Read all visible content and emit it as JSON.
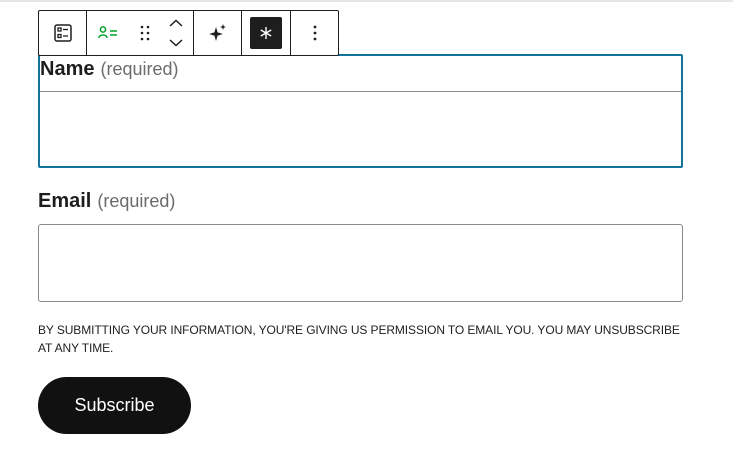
{
  "toolbar": {
    "buttons": [
      {
        "icon": "form-block-icon"
      },
      {
        "icon": "person-lines-icon",
        "color": "#00a32a"
      },
      {
        "icon": "drag-handle-icon"
      },
      {
        "icon": "chevron-up-icon"
      },
      {
        "icon": "chevron-down-icon"
      },
      {
        "icon": "sparkle-icon"
      },
      {
        "icon": "asterisk-icon",
        "active": true
      },
      {
        "icon": "more-options-icon"
      }
    ]
  },
  "fields": {
    "name": {
      "label": "Name",
      "required": "(required)",
      "value": ""
    },
    "email": {
      "label": "Email",
      "required": "(required)",
      "value": ""
    }
  },
  "disclaimer": "BY SUBMITTING YOUR INFORMATION, YOU'RE GIVING US PERMISSION TO EMAIL YOU. YOU MAY UNSUBSCRIBE AT ANY TIME.",
  "subscribe_label": "Subscribe",
  "colors": {
    "focus_border": "#13739b",
    "button_bg": "#111111",
    "accent_green": "#00a32a"
  }
}
